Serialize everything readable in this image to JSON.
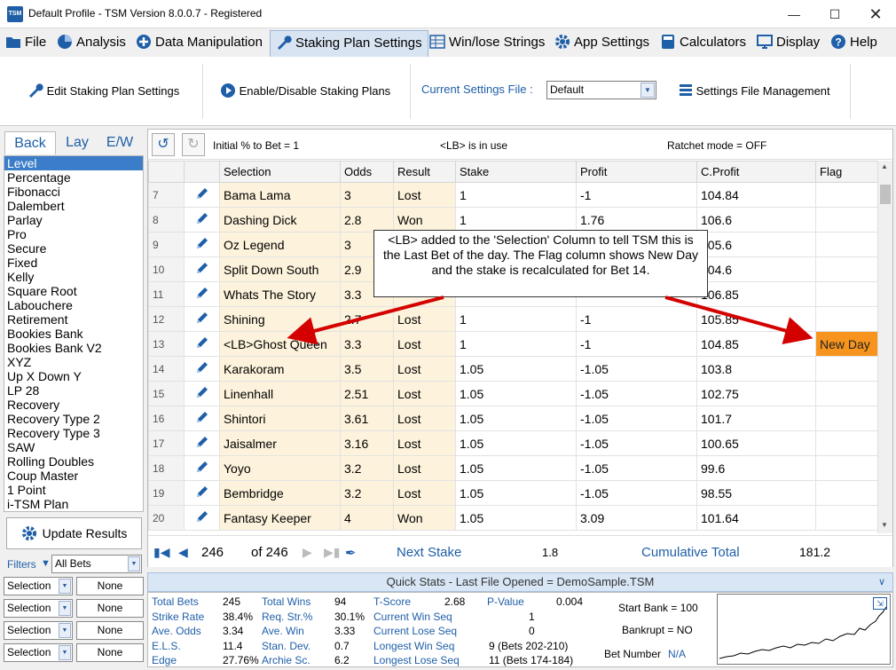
{
  "window": {
    "title": "Default Profile  -  TSM Version 8.0.0.7 - Registered",
    "logo": "TSM"
  },
  "menu": {
    "items": [
      {
        "label": "File",
        "icon": "folder-icon"
      },
      {
        "label": "Analysis",
        "icon": "pie-chart-icon"
      },
      {
        "label": "Data Manipulation",
        "icon": "plus-circle-icon"
      },
      {
        "label": "Staking Plan Settings",
        "icon": "wrench-icon"
      },
      {
        "label": "Win/lose Strings",
        "icon": "table-icon"
      },
      {
        "label": "App Settings",
        "icon": "gear-icon"
      },
      {
        "label": "Calculators",
        "icon": "calculator-icon"
      },
      {
        "label": "Display",
        "icon": "monitor-icon"
      },
      {
        "label": "Help",
        "icon": "help-icon"
      }
    ]
  },
  "toolbar": {
    "edit_label": "Edit Staking Plan Settings",
    "enable_label": "Enable/Disable Staking Plans",
    "current_file_label": "Current Settings File :",
    "current_file_value": "Default",
    "file_mgmt_label": "Settings File Management"
  },
  "left": {
    "tabs": [
      "Back",
      "Lay",
      "E/W"
    ],
    "plans": [
      "Level",
      "Percentage",
      "Fibonacci",
      "Dalembert",
      "Parlay",
      "Pro",
      "Secure",
      "Fixed",
      "Kelly",
      "Square Root",
      "Labouchere",
      "Retirement",
      "Bookies Bank",
      "Bookies Bank V2",
      "XYZ",
      "Up X Down Y",
      "LP 28",
      "Recovery",
      "Recovery Type 2",
      "Recovery Type 3",
      "SAW",
      "Rolling Doubles",
      "Coup Master",
      "1 Point",
      "i-TSM Plan"
    ],
    "selected_index": 0,
    "update_label": "Update Results",
    "filters_label": "Filters",
    "filters_value": "All Bets",
    "filter_rows": [
      {
        "field": "Selection",
        "value": "None"
      },
      {
        "field": "Selection",
        "value": "None"
      },
      {
        "field": "Selection",
        "value": "None"
      },
      {
        "field": "Selection",
        "value": "None"
      }
    ]
  },
  "grid_toolbar": {
    "initial_pct": "Initial % to Bet = 1",
    "lb_status": "<LB> is in use",
    "ratchet": "Ratchet mode = OFF"
  },
  "grid": {
    "headers": [
      "Selection",
      "Odds",
      "Result",
      "Stake",
      "Profit",
      "C.Profit",
      "Flag"
    ],
    "rows": [
      {
        "n": "7",
        "selection": "Bama Lama",
        "odds": "3",
        "result": "Lost",
        "stake": "1",
        "profit": "-1",
        "cprofit": "104.84",
        "flag": ""
      },
      {
        "n": "8",
        "selection": "Dashing Dick",
        "odds": "2.8",
        "result": "Won",
        "stake": "1",
        "profit": "1.76",
        "cprofit": "106.6",
        "flag": ""
      },
      {
        "n": "9",
        "selection": "Oz Legend",
        "odds": "3",
        "result": "",
        "stake": "",
        "profit": "",
        "cprofit": "105.6",
        "flag": ""
      },
      {
        "n": "10",
        "selection": "Split Down South",
        "odds": "2.9",
        "result": "",
        "stake": "",
        "profit": "",
        "cprofit": "104.6",
        "flag": ""
      },
      {
        "n": "11",
        "selection": "Whats The Story",
        "odds": "3.3",
        "result": "",
        "stake": "",
        "profit": "",
        "cprofit": "106.85",
        "flag": ""
      },
      {
        "n": "12",
        "selection": "Shining",
        "odds": "2.7",
        "result": "Lost",
        "stake": "1",
        "profit": "-1",
        "cprofit": "105.85",
        "flag": ""
      },
      {
        "n": "13",
        "selection": "<LB>Ghost Queen",
        "odds": "3.3",
        "result": "Lost",
        "stake": "1",
        "profit": "-1",
        "cprofit": "104.85",
        "flag": "New Day"
      },
      {
        "n": "14",
        "selection": "Karakoram",
        "odds": "3.5",
        "result": "Lost",
        "stake": "1.05",
        "profit": "-1.05",
        "cprofit": "103.8",
        "flag": ""
      },
      {
        "n": "15",
        "selection": "Linenhall",
        "odds": "2.51",
        "result": "Lost",
        "stake": "1.05",
        "profit": "-1.05",
        "cprofit": "102.75",
        "flag": ""
      },
      {
        "n": "16",
        "selection": "Shintori",
        "odds": "3.61",
        "result": "Lost",
        "stake": "1.05",
        "profit": "-1.05",
        "cprofit": "101.7",
        "flag": ""
      },
      {
        "n": "17",
        "selection": "Jaisalmer",
        "odds": "3.16",
        "result": "Lost",
        "stake": "1.05",
        "profit": "-1.05",
        "cprofit": "100.65",
        "flag": ""
      },
      {
        "n": "18",
        "selection": "Yoyo",
        "odds": "3.2",
        "result": "Lost",
        "stake": "1.05",
        "profit": "-1.05",
        "cprofit": "99.6",
        "flag": ""
      },
      {
        "n": "19",
        "selection": "Bembridge",
        "odds": "3.2",
        "result": "Lost",
        "stake": "1.05",
        "profit": "-1.05",
        "cprofit": "98.55",
        "flag": ""
      },
      {
        "n": "20",
        "selection": "Fantasy Keeper",
        "odds": "4",
        "result": "Won",
        "stake": "1.05",
        "profit": "3.09",
        "cprofit": "101.64",
        "flag": ""
      }
    ]
  },
  "callout": {
    "text": "<LB> added to the 'Selection' Column to tell TSM this is the Last Bet of the day. The Flag column shows New Day and the stake is recalculated for Bet 14."
  },
  "nav": {
    "current": "246",
    "of": "of 246",
    "next_stake_label": "Next Stake",
    "next_stake_value": "1.8",
    "cum_label": "Cumulative Total",
    "cum_value": "181.2"
  },
  "quickstats": {
    "header": "Quick Stats - Last File Opened = DemoSample.TSM",
    "col1": [
      [
        "Total Bets",
        "245"
      ],
      [
        "Strike Rate",
        "38.4%"
      ],
      [
        "Ave. Odds",
        "3.34"
      ],
      [
        "E.L.S.",
        "11.4"
      ],
      [
        "Edge",
        "27.76%"
      ]
    ],
    "col2": [
      [
        "Total Wins",
        "94"
      ],
      [
        "Req. Str.%",
        "30.1%"
      ],
      [
        "Ave. Win",
        "3.33"
      ],
      [
        "Stan. Dev.",
        "0.7"
      ],
      [
        "Archie Sc.",
        "6.2"
      ]
    ],
    "col3": [
      [
        "T-Score",
        "2.68"
      ],
      [
        "Current Win Seq",
        "1"
      ],
      [
        "Current Lose Seq",
        "0"
      ],
      [
        "Longest Win Seq",
        "9  (Bets 202-210)"
      ],
      [
        "Longest Lose Seq",
        "11  (Bets 174-184)"
      ]
    ],
    "pvalue_label": "P-Value",
    "pvalue": "0.004",
    "start_bank": "Start Bank = 100",
    "bankrupt": "Bankrupt = NO",
    "bet_number_label": "Bet Number",
    "bet_number_value": "N/A"
  },
  "colors": {
    "accent": "#1f5fa8",
    "highlight": "#fdf3dc",
    "flag": "#f7941d",
    "arrow": "#d40000"
  }
}
